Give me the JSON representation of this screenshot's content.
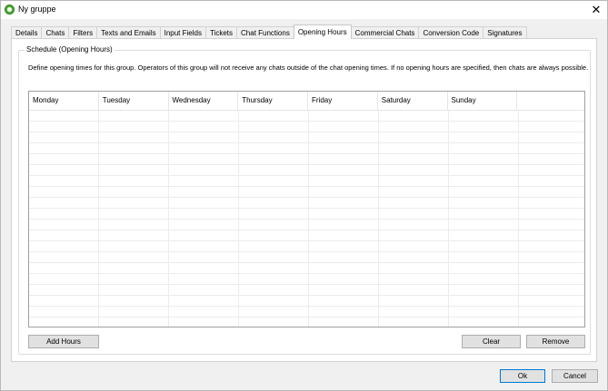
{
  "window": {
    "title": "Ny gruppe",
    "close_label": "✕"
  },
  "tabs": [
    {
      "label": "Details",
      "active": false
    },
    {
      "label": "Chats",
      "active": false
    },
    {
      "label": "Filters",
      "active": false
    },
    {
      "label": "Texts and Emails",
      "active": false
    },
    {
      "label": "Input Fields",
      "active": false
    },
    {
      "label": "Tickets",
      "active": false
    },
    {
      "label": "Chat Functions",
      "active": false
    },
    {
      "label": "Opening Hours",
      "active": true
    },
    {
      "label": "Commercial Chats",
      "active": false
    },
    {
      "label": "Conversion Code",
      "active": false
    },
    {
      "label": "Signatures",
      "active": false
    }
  ],
  "schedule": {
    "group_title": "Schedule (Opening Hours)",
    "description": "Define opening times for this group. Operators of this group will not receive any chats outside of the chat opening times. If no opening hours are specified, then chats are always possible.",
    "columns": [
      "Monday",
      "Tuesday",
      "Wednesday",
      "Thursday",
      "Friday",
      "Saturday",
      "Sunday"
    ],
    "add_hours_label": "Add Hours",
    "clear_label": "Clear",
    "remove_label": "Remove"
  },
  "footer": {
    "ok_label": "Ok",
    "cancel_label": "Cancel"
  },
  "colors": {
    "accent": "#0078d7",
    "app_icon": "#4caf33"
  }
}
